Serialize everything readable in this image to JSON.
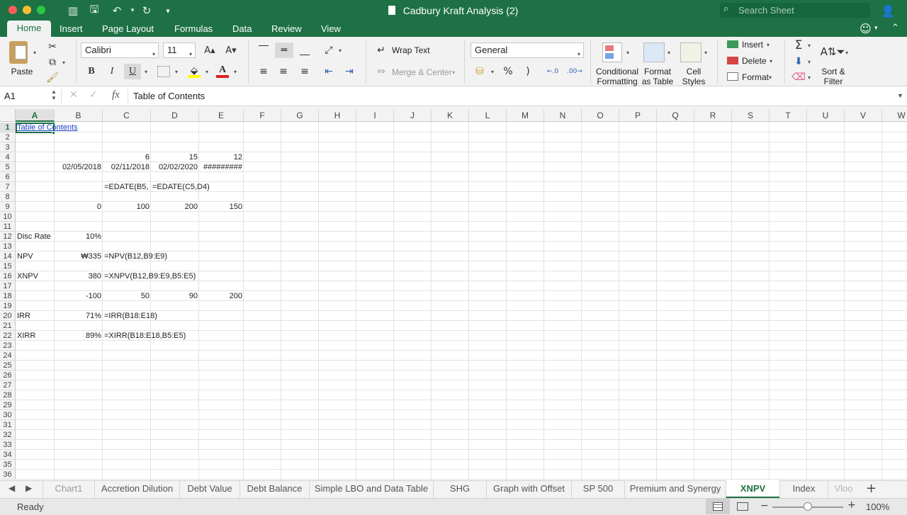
{
  "window": {
    "title": "Cadbury Kraft Analysis (2)",
    "search_placeholder": "Search Sheet"
  },
  "ribbon_tabs": [
    "Home",
    "Insert",
    "Page Layout",
    "Formulas",
    "Data",
    "Review",
    "View"
  ],
  "ribbon": {
    "paste": "Paste",
    "font_name": "Calibri",
    "font_size": "11",
    "bold": "B",
    "italic": "I",
    "underline": "U",
    "wrap_text": "Wrap Text",
    "merge_center": "Merge & Center",
    "number_format": "General",
    "percent": "%",
    "comma": ")",
    "conditional_formatting": [
      "Conditional",
      "Formatting"
    ],
    "format_as_table": [
      "Format",
      "as Table"
    ],
    "cell_styles": [
      "Cell",
      "Styles"
    ],
    "insert": "Insert",
    "delete": "Delete",
    "format": "Format",
    "sort_filter": [
      "Sort &",
      "Filter"
    ]
  },
  "formula_bar": {
    "cell_ref": "A1",
    "fx": "fx",
    "content": "Table of Contents"
  },
  "columns": [
    "A",
    "B",
    "C",
    "D",
    "E",
    "F",
    "G",
    "H",
    "I",
    "J",
    "K",
    "L",
    "M",
    "N",
    "O",
    "P",
    "Q",
    "R",
    "S",
    "T",
    "U",
    "V",
    "W"
  ],
  "rows": [
    "1",
    "2",
    "3",
    "4",
    "5",
    "6",
    "7",
    "8",
    "9",
    "10",
    "11",
    "12",
    "13",
    "14",
    "15",
    "16",
    "17",
    "18",
    "19",
    "20",
    "21",
    "22",
    "23",
    "24",
    "25",
    "26",
    "27",
    "28",
    "29",
    "30",
    "31",
    "32",
    "33",
    "34",
    "35",
    "36"
  ],
  "cells": {
    "a1": "Table of Contents",
    "c4": "6",
    "d4": "15",
    "e4": "12",
    "b5": "02/05/2018",
    "c5": "02/11/2018",
    "d5": "02/02/2020",
    "e5": "#########",
    "c7": "=EDATE(B5,",
    "d7": "=EDATE(C5,D4)",
    "b9": "0",
    "c9": "100",
    "d9": "200",
    "e9": "150",
    "a12": "Disc Rate",
    "b12": "10%",
    "a14": "NPV",
    "b14": "₩335",
    "c14": "=NPV(B12,B9:E9)",
    "a16": "XNPV",
    "b16": "380",
    "c16": "=XNPV(B12,B9:E9,B5:E5)",
    "b18": "-100",
    "c18": "50",
    "d18": "90",
    "e18": "200",
    "a20": "IRR",
    "b20": "71%",
    "c20": "=IRR(B18:E18)",
    "a22": "XIRR",
    "b22": "89%",
    "c22": "=XIRR(B18:E18,B5:E5)"
  },
  "sheet_tabs": [
    "Chart1",
    "Accretion Dilution",
    "Debt Value",
    "Debt Balance",
    "Simple LBO and Data Table",
    "SHG",
    "Graph with Offset",
    "SP 500",
    "Premium and Synergy",
    "XNPV",
    "Index",
    "Vloo"
  ],
  "active_sheet": "XNPV",
  "status": {
    "ready": "Ready",
    "zoom": "100%"
  }
}
